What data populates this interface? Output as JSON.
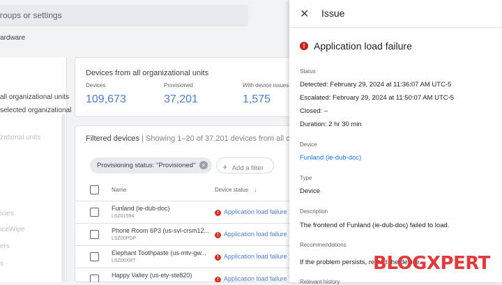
{
  "search": {
    "placeholder": "roups or settings"
  },
  "sidebar": {
    "hardware_label": "ardware",
    "ou_items": [
      "all organizational units",
      "selected organizational"
    ],
    "faded_items": [
      "zational units",
      "",
      "",
      "icies",
      "iceWipe",
      "ers",
      "s"
    ]
  },
  "stats": {
    "title": "Devices from all organizational units",
    "items": [
      {
        "label": "Devices",
        "value": "109,673"
      },
      {
        "label": "Provisioned",
        "value": "37,201"
      },
      {
        "label": "With device issues",
        "value": "1,575"
      }
    ]
  },
  "table": {
    "heading": "Filtered devices",
    "subheading": "| Showing 1–20 of 37,201 devices from all o",
    "filter_chip": "Provisioning status: \"Provisioned\"",
    "add_filter": "Add a filter",
    "col_name": "Name",
    "col_status": "Device status",
    "rows": [
      {
        "name": "Funland (ie-dub-doc)",
        "id": "LSZ01594",
        "status": "Application load failure"
      },
      {
        "name": "Phone Room 6P3 (us-svl-crsm12...",
        "id": "LSZ00PDP",
        "status": "Application load failure"
      },
      {
        "name": "Elephant Toothpaste (us-mtv-gw...",
        "id": "LSZ00XRT",
        "status": "Application load failure"
      },
      {
        "name": "Happy Valley (us-ety-ste820)",
        "id": "",
        "status": "Application load failure"
      }
    ]
  },
  "panel": {
    "title": "Issue",
    "issue_title": "Application load failure",
    "status_label": "Status",
    "detected": "Detected: February 29, 2024 at 11:36:07 AM UTC-5",
    "escalated": "Escalated: February 29, 2024 at 11:50:07 AM UTC-5",
    "closed": "Closed: –",
    "duration": "Duration: 2 hr 30 min",
    "device_label": "Device",
    "device_link": "Funland (ie-dub-doc)",
    "type_label": "Type",
    "type_value": "Device",
    "description_label": "Description",
    "description_value": "The frontend of Funland (ie-dub-doc) failed to load.",
    "recommendations_label": "Recommendations",
    "recommendations_value": "If the problem persists, restart the device.",
    "relevant_label": "Relevant history"
  },
  "watermark": "BLOGXPERT",
  "colors": {
    "accent": "#4c7dd1",
    "error": "#d93025",
    "link": "#1a73e8"
  }
}
